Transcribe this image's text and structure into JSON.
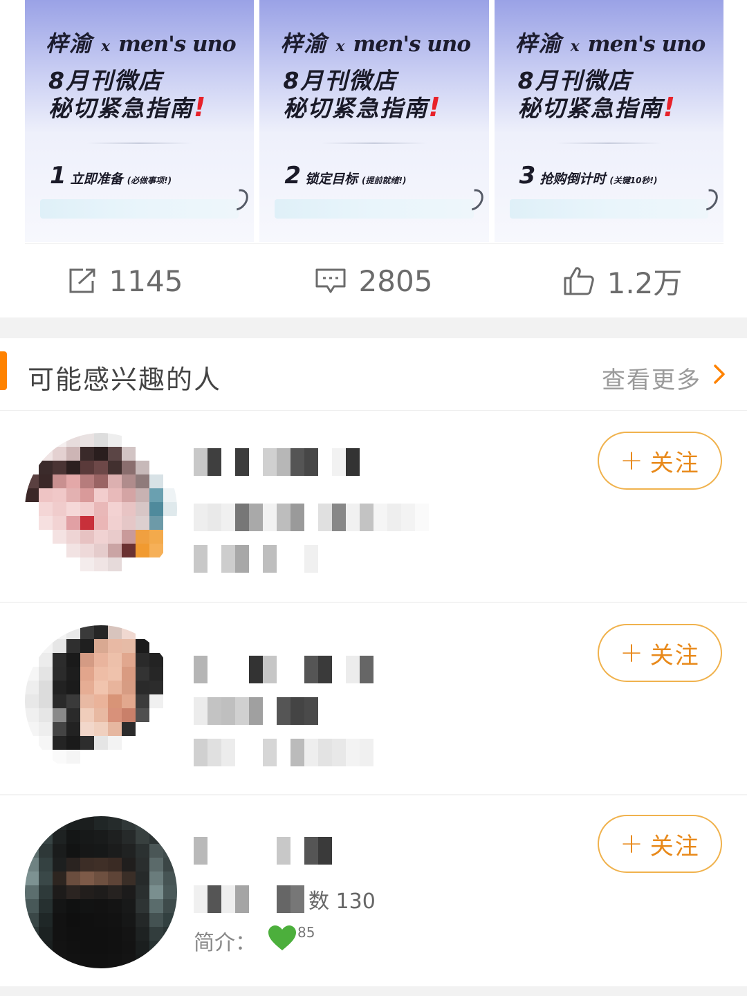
{
  "cards": [
    {
      "brand_name": "梓渝",
      "brand_x": "x",
      "brand_mag": "men's uno",
      "line1": "8月刊微店",
      "line2": "秘切紧急指南",
      "bang": "!",
      "step_num": "1",
      "step_text": "立即准备",
      "step_note": "(必做事项!)"
    },
    {
      "brand_name": "梓渝",
      "brand_x": "x",
      "brand_mag": "men's uno",
      "line1": "8月刊微店",
      "line2": "秘切紧急指南",
      "bang": "!",
      "step_num": "2",
      "step_text": "锁定目标",
      "step_note": "(提前就绪!)"
    },
    {
      "brand_name": "梓渝",
      "brand_x": "x",
      "brand_mag": "men's uno",
      "line1": "8月刊微店",
      "line2": "秘切紧急指南",
      "bang": "!",
      "step_num": "3",
      "step_text": "抢购倒计时",
      "step_note": "(关键10秒!)"
    }
  ],
  "actions": {
    "repost": {
      "icon": "share-icon",
      "count": "1145"
    },
    "comment": {
      "icon": "comment-icon",
      "count": "2805"
    },
    "like": {
      "icon": "thumbs-up-icon",
      "count": "1.2万"
    }
  },
  "section": {
    "title": "可能感兴趣的人",
    "more": "查看更多",
    "accent_color": "#ff8200"
  },
  "users": [
    {
      "follow_label": "关注",
      "follow_plus": "+"
    },
    {
      "follow_label": "关注",
      "follow_plus": "+"
    },
    {
      "follow_label": "关注",
      "follow_plus": "+",
      "fans_visible": "数 130",
      "intro_label": "简介：",
      "heart_count": "85"
    }
  ],
  "colors": {
    "follow": "#e8891a",
    "follow_border": "#f0b24d",
    "heart": "#4caf3c"
  }
}
